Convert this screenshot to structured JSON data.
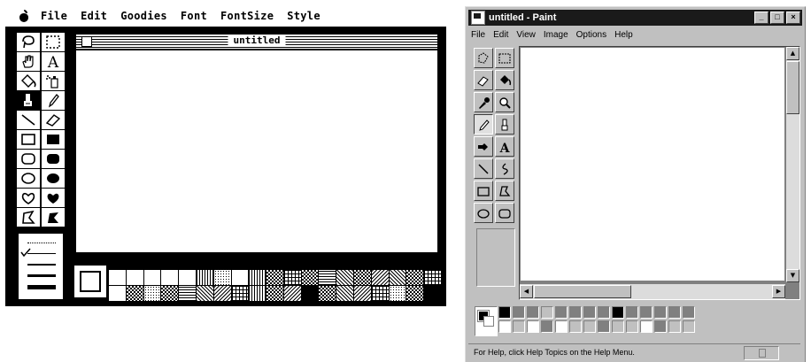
{
  "macpaint": {
    "menu": [
      "File",
      "Edit",
      "Goodies",
      "Font",
      "FontSize",
      "Style"
    ],
    "window_title": "untitled",
    "tools": [
      "lasso-icon",
      "marquee-icon",
      "hand-icon",
      "text-tool-icon",
      "bucket-icon",
      "spray-can-icon",
      "paintbrush-icon",
      "pencil-icon",
      "line-icon",
      "eraser-icon",
      "rectangle-icon",
      "filled-rectangle-icon",
      "rounded-rect-icon",
      "filled-rounded-rect-icon",
      "oval-icon",
      "filled-oval-icon",
      "freeform-icon",
      "filled-freeform-icon",
      "polygon-icon",
      "filled-polygon-icon"
    ],
    "text_tool_glyph": "A"
  },
  "mspaint": {
    "title": "untitled - Paint",
    "menu": [
      "File",
      "Edit",
      "View",
      "Image",
      "Options",
      "Help"
    ],
    "caption_buttons": [
      "_",
      "□",
      "×"
    ],
    "tools": [
      "free-select-icon",
      "rect-select-icon",
      "eraser-icon",
      "fill-icon",
      "color-picker-icon",
      "magnifier-icon",
      "pencil-icon",
      "brush-icon",
      "airbrush-icon",
      "text-icon",
      "line-icon",
      "curve-icon",
      "rectangle-icon",
      "polygon-icon",
      "ellipse-icon",
      "rounded-rect-icon"
    ],
    "text_tool_glyph": "A",
    "status_text": "For Help, click Help Topics on the Help Menu.",
    "palette": [
      "#000000",
      "#808080",
      "#808080",
      "#c0c0c0",
      "#808080",
      "#808080",
      "#808080",
      "#808080",
      "#000000",
      "#808080",
      "#808080",
      "#808080",
      "#808080",
      "#808080",
      "#ffffff",
      "#c0c0c0",
      "#ffffff",
      "#808080",
      "#ffffff",
      "#c0c0c0",
      "#c0c0c0",
      "#808080",
      "#c0c0c0",
      "#c0c0c0",
      "#ffffff",
      "#808080",
      "#c0c0c0",
      "#c0c0c0"
    ]
  }
}
